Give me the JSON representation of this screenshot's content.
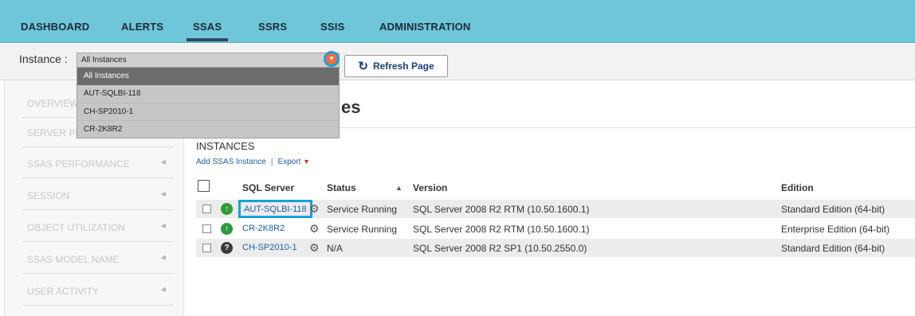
{
  "nav": {
    "tabs": [
      {
        "label": "DASHBOARD"
      },
      {
        "label": "ALERTS"
      },
      {
        "label": "SSAS"
      },
      {
        "label": "SSRS"
      },
      {
        "label": "SSIS"
      },
      {
        "label": "ADMINISTRATION"
      }
    ],
    "active": "SSAS"
  },
  "instance": {
    "label": "Instance :",
    "selected": "All Instances",
    "options": [
      "All Instances",
      "AUT-SQLBI-118",
      "CH-SP2010-1",
      "CR-2K8R2"
    ],
    "refresh_label": "Refresh Page"
  },
  "sidebar": {
    "items": [
      {
        "label": "OVERVIEW",
        "arrow": ""
      },
      {
        "label": "SERVER PERFORMANCE",
        "arrow": ""
      },
      {
        "label": "SSAS PERFORMANCE",
        "arrow": "◀"
      },
      {
        "label": "SESSION",
        "arrow": "◀"
      },
      {
        "label": "OBJECT UTILIZATION",
        "arrow": "◀"
      },
      {
        "label": "SSAS MODEL NAME",
        "arrow": "◀"
      },
      {
        "label": "USER ACTIVITY",
        "arrow": "◀"
      }
    ]
  },
  "main": {
    "title": "es",
    "section": "INSTANCES",
    "add_link": "Add SSAS Instance",
    "separator": "|",
    "export_link": "Export",
    "columns": {
      "server": "SQL Server",
      "status": "Status",
      "version": "Version",
      "version_sort": "▲",
      "edition": "Edition"
    },
    "rows": [
      {
        "server": "AUT-SQLBI-118",
        "status": "Service Running",
        "version": "SQL Server 2008 R2 RTM (10.50.1600.1)",
        "edition": "Standard Edition (64-bit)",
        "state": "up"
      },
      {
        "server": "CR-2K8R2",
        "status": "Service Running",
        "version": "SQL Server 2008 R2 RTM (10.50.1600.1)",
        "edition": "Enterprise Edition (64-bit)",
        "state": "up"
      },
      {
        "server": "CH-SP2010-1",
        "status": "N/A",
        "version": "SQL Server 2008 R2 SP1 (10.50.2550.0)",
        "edition": "Standard Edition (64-bit)",
        "state": "unknown"
      }
    ]
  },
  "colors": {
    "nav_bg": "#6ec6d8",
    "link": "#1e5fa3",
    "highlight": "#1aa0d8",
    "running": "#2e9a3c"
  }
}
